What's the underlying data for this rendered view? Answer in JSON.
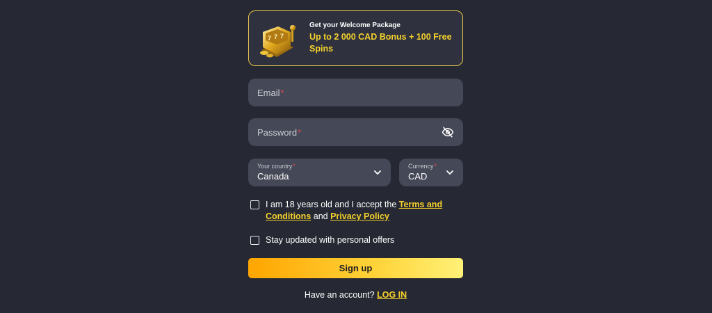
{
  "promo": {
    "subtitle": "Get your Welcome Package",
    "title": "Up to 2 000 CAD Bonus + 100 Free Spins",
    "icon": "slot-machine-icon"
  },
  "email": {
    "label": "Email",
    "required_mark": "*"
  },
  "password": {
    "label": "Password",
    "required_mark": "*",
    "toggle_icon": "eye-off-icon"
  },
  "country": {
    "label": "Your country",
    "required_mark": "*",
    "value": "Canada"
  },
  "currency": {
    "label": "Currency",
    "required_mark": "*",
    "value": "CAD"
  },
  "terms": {
    "text_before": "I am 18 years old and I accept the",
    "terms_link": "Terms and Conditions",
    "and": "and",
    "privacy_link": "Privacy Policy"
  },
  "offers": {
    "text": "Stay updated with personal offers"
  },
  "signup": {
    "label": "Sign up"
  },
  "footer": {
    "text": "Have an account?",
    "login_link": "LOG IN"
  },
  "colors": {
    "background": "#262933",
    "field": "#454856",
    "accent": "#f5d12c",
    "required": "#e5484d"
  }
}
